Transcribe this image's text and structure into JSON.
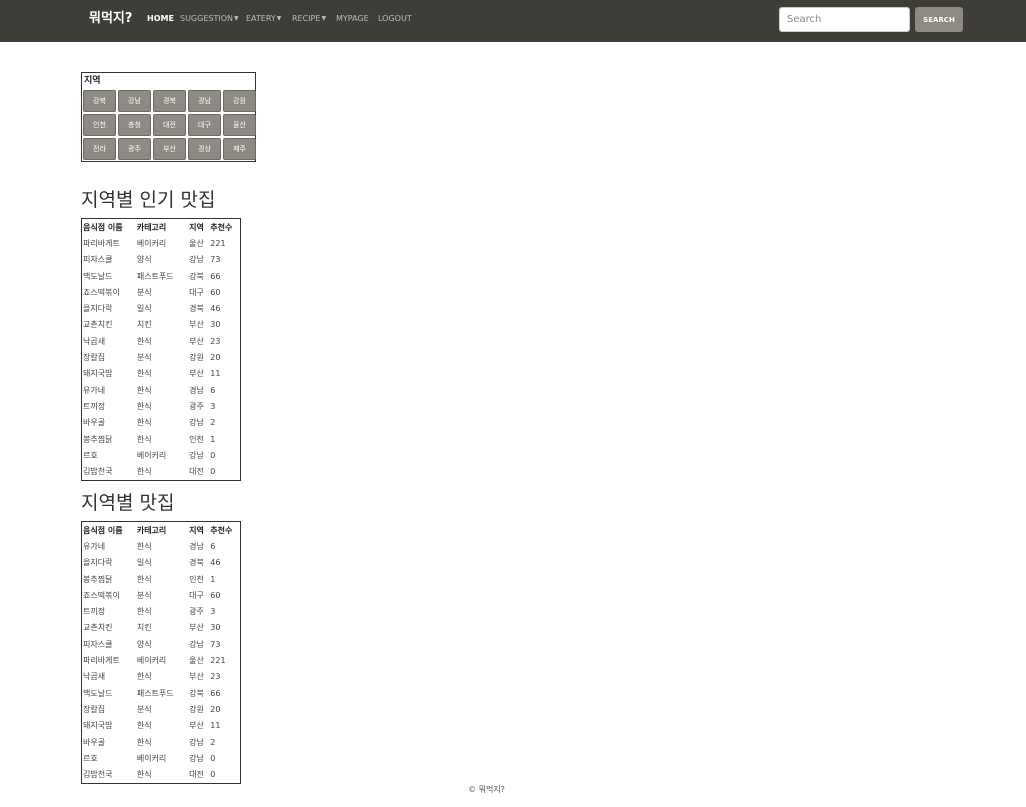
{
  "navbar": {
    "brand": "뭐먹지?",
    "links": [
      {
        "label": "HOME",
        "active": true,
        "dropdown": false
      },
      {
        "label": "SUGGESTION",
        "active": false,
        "dropdown": true
      },
      {
        "label": "EATERY",
        "active": false,
        "dropdown": true
      },
      {
        "label": "RECIPE",
        "active": false,
        "dropdown": true
      },
      {
        "label": "MYPAGE",
        "active": false,
        "dropdown": false
      },
      {
        "label": "LOGOUT",
        "active": false,
        "dropdown": false
      }
    ],
    "search_placeholder": "Search",
    "search_button": "SEARCH",
    "caret_icon": "caret-down-icon"
  },
  "region": {
    "title": "지역",
    "buttons": [
      "강북",
      "강남",
      "경북",
      "경남",
      "강원",
      "인천",
      "충청",
      "대전",
      "대구",
      "울산",
      "전라",
      "광주",
      "부산",
      "경상",
      "제주"
    ]
  },
  "popular": {
    "title": "지역별 인기 맛집",
    "headers": [
      "음식점 이름",
      "카테고리",
      "지역",
      "추천수"
    ],
    "rows": [
      [
        "파리바게트",
        "베이커리",
        "울산",
        "221"
      ],
      [
        "피자스쿨",
        "양식",
        "강남",
        "73"
      ],
      [
        "맥도날드",
        "패스트푸드",
        "강북",
        "66"
      ],
      [
        "죠스떡볶이",
        "분식",
        "대구",
        "60"
      ],
      [
        "을지다락",
        "일식",
        "경북",
        "46"
      ],
      [
        "교촌치킨",
        "치킨",
        "부산",
        "30"
      ],
      [
        "낙곱새",
        "한식",
        "부산",
        "23"
      ],
      [
        "장칼집",
        "분식",
        "강원",
        "20"
      ],
      [
        "돼지국밥",
        "한식",
        "부산",
        "11"
      ],
      [
        "유가네",
        "한식",
        "경남",
        "6"
      ],
      [
        "트끼정",
        "한식",
        "광주",
        "3"
      ],
      [
        "바우골",
        "한식",
        "강남",
        "2"
      ],
      [
        "봉추찜닭",
        "한식",
        "인천",
        "1"
      ],
      [
        "르호",
        "베이커리",
        "강남",
        "0"
      ],
      [
        "김밥천국",
        "한식",
        "대전",
        "0"
      ]
    ]
  },
  "all": {
    "title": "지역별 맛집",
    "headers": [
      "음식점 이름",
      "카테고리",
      "지역",
      "추천수"
    ],
    "rows": [
      [
        "유가네",
        "한식",
        "경남",
        "6"
      ],
      [
        "을지다락",
        "일식",
        "경북",
        "46"
      ],
      [
        "봉추찜닭",
        "한식",
        "인천",
        "1"
      ],
      [
        "죠스떡볶이",
        "분식",
        "대구",
        "60"
      ],
      [
        "트끼정",
        "한식",
        "광주",
        "3"
      ],
      [
        "교촌치킨",
        "치킨",
        "부산",
        "30"
      ],
      [
        "피자스쿨",
        "양식",
        "강남",
        "73"
      ],
      [
        "파리바게트",
        "베이커리",
        "울산",
        "221"
      ],
      [
        "낙곱새",
        "한식",
        "부산",
        "23"
      ],
      [
        "맥도날드",
        "패스트푸드",
        "강북",
        "66"
      ],
      [
        "장칼집",
        "분식",
        "강원",
        "20"
      ],
      [
        "돼지국밥",
        "한식",
        "부산",
        "11"
      ],
      [
        "바우골",
        "한식",
        "강남",
        "2"
      ],
      [
        "르호",
        "베이커리",
        "강남",
        "0"
      ],
      [
        "김밥천국",
        "한식",
        "대전",
        "0"
      ]
    ]
  },
  "footer": "© 뭐먹지?"
}
